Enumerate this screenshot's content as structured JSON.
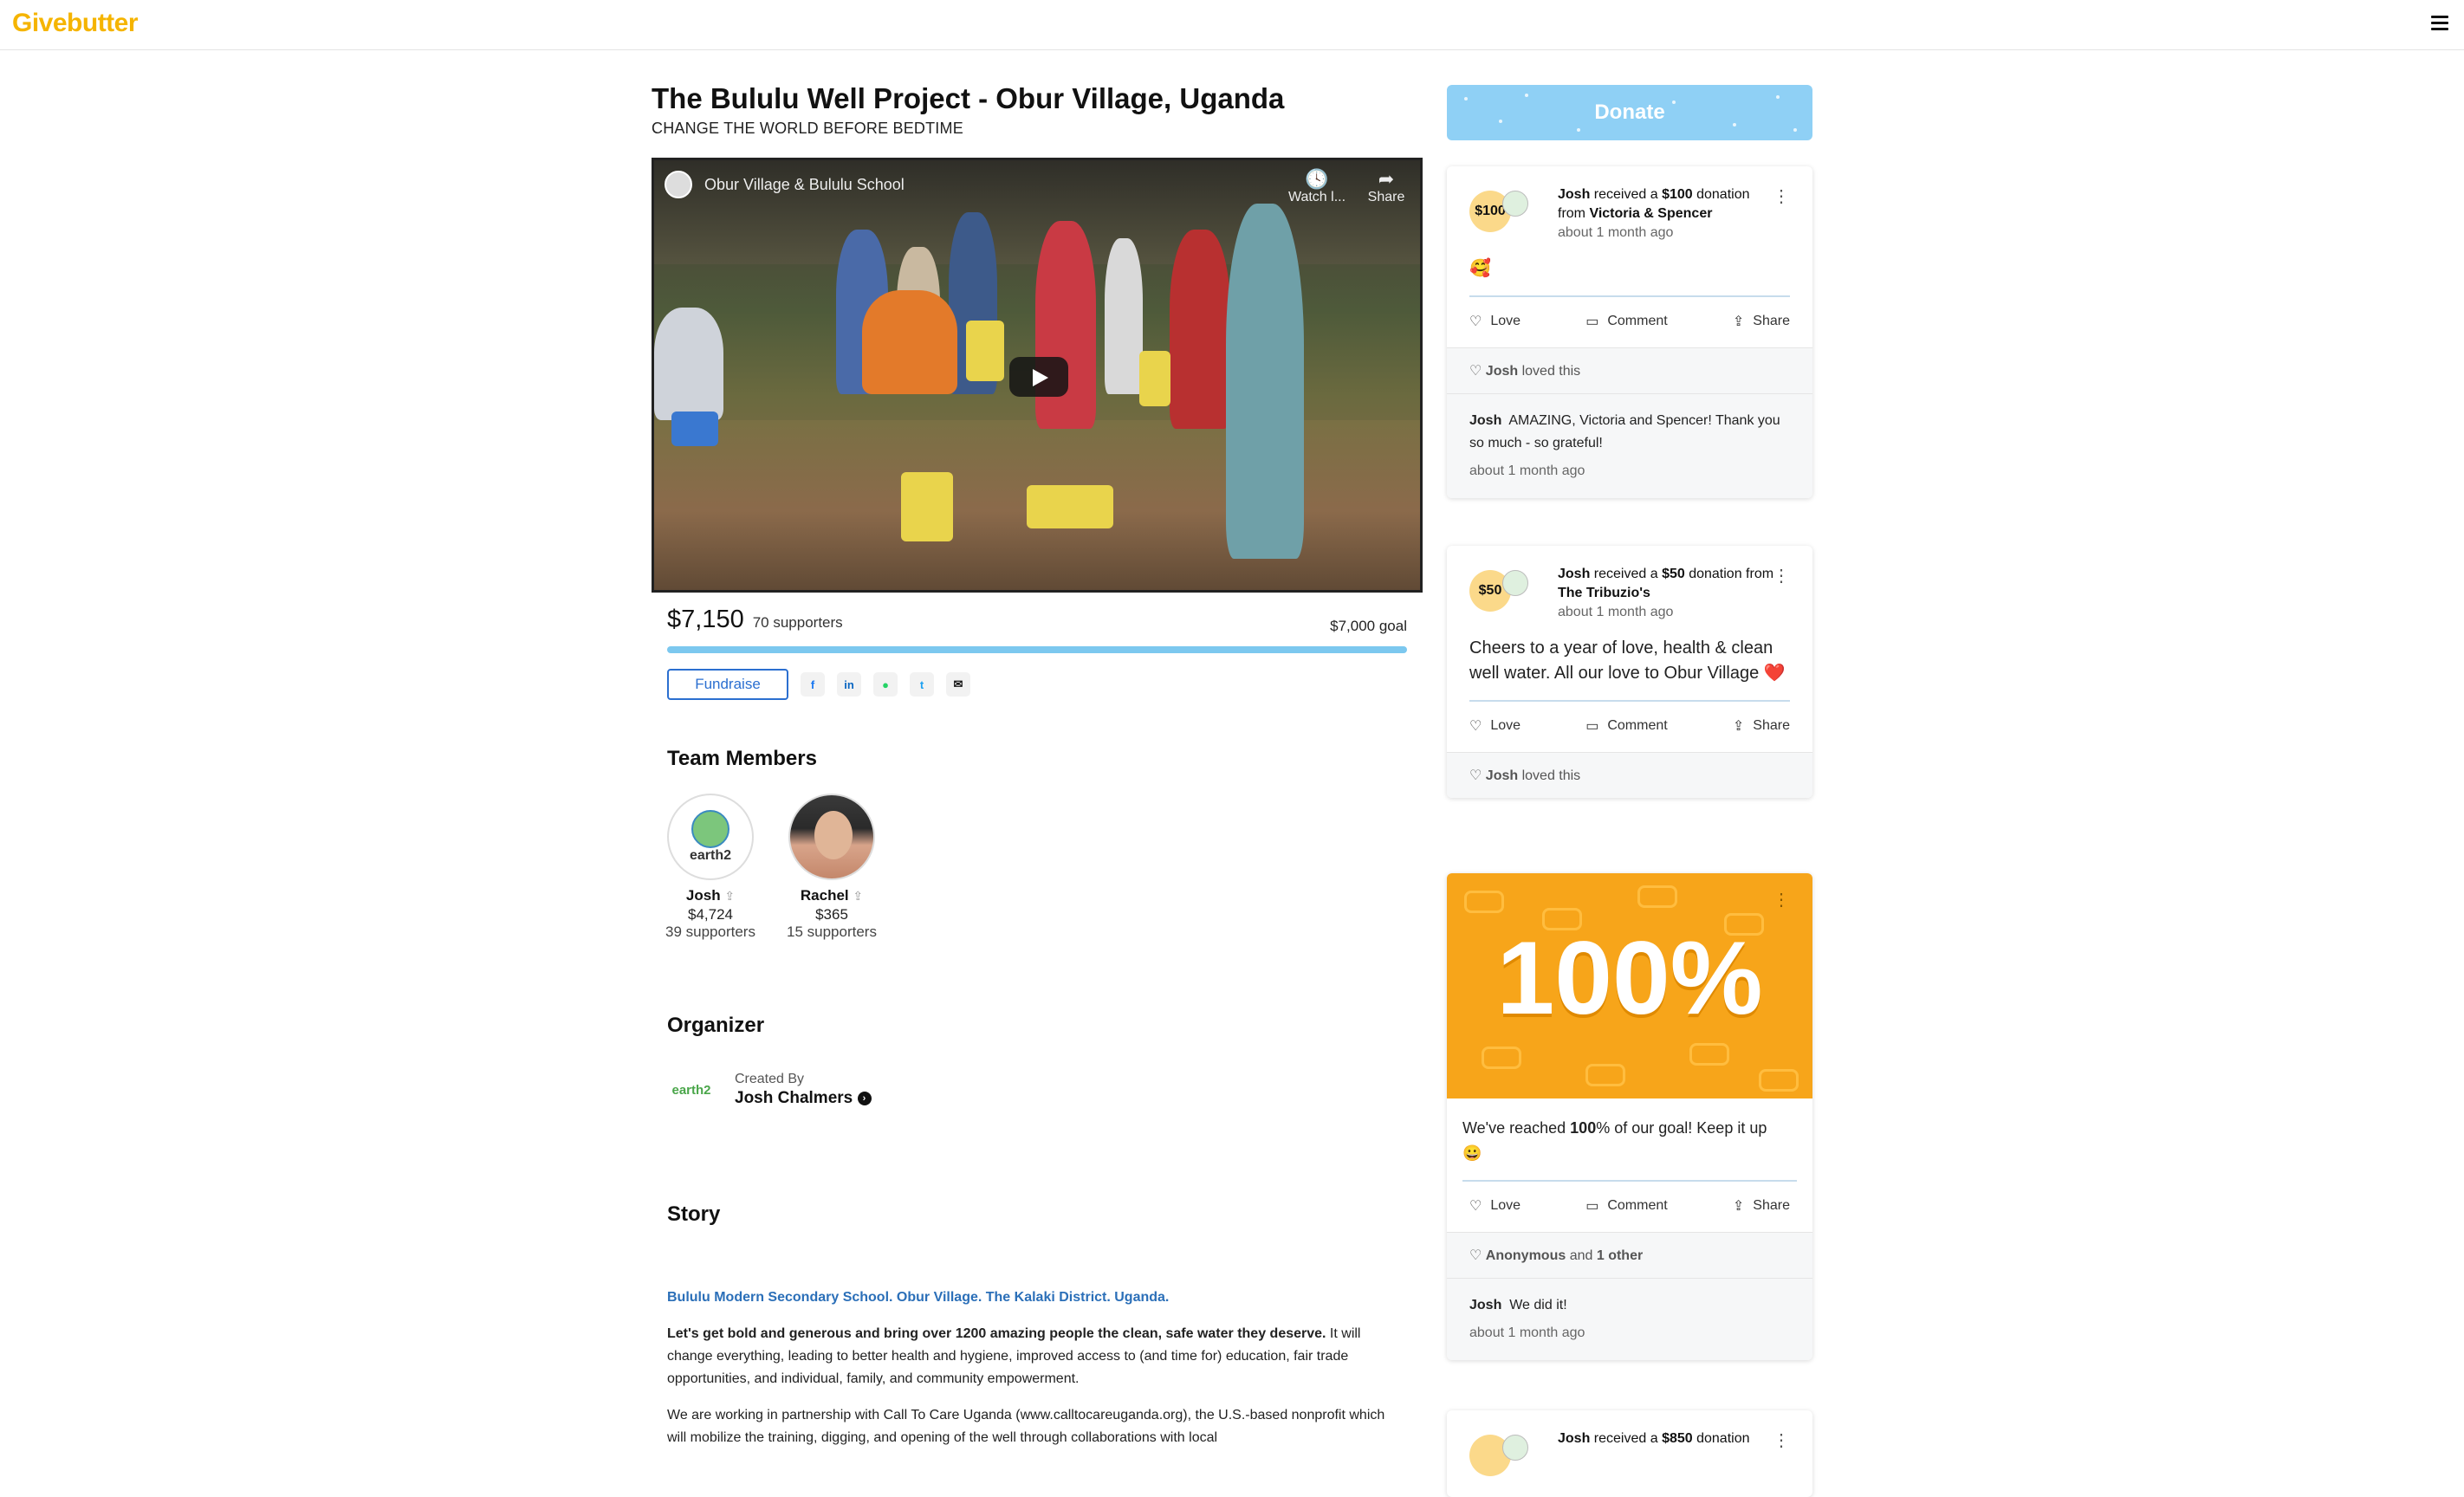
{
  "header": {
    "logo": "Givebutter"
  },
  "campaign": {
    "title": "The Bululu Well Project - Obur Village, Uganda",
    "subtitle": "CHANGE THE WORLD BEFORE BEDTIME",
    "video": {
      "channel_title": "Obur Village & Bululu School",
      "watch_label": "Watch l...",
      "share_label": "Share"
    },
    "raised": "$7,150",
    "supporters": "70 supporters",
    "goal": "$7,000 goal",
    "progress_fraction": 1.0,
    "fundraise_label": "Fundraise",
    "share_icons": [
      "facebook-icon",
      "linkedin-icon",
      "whatsapp-icon",
      "twitter-icon",
      "email-icon"
    ]
  },
  "team": {
    "heading": "Team Members",
    "members": [
      {
        "name": "Josh",
        "amount": "$4,724",
        "supporters": "39 supporters",
        "avatar_text": "earth2"
      },
      {
        "name": "Rachel",
        "amount": "$365",
        "supporters": "15 supporters"
      }
    ]
  },
  "organizer": {
    "heading": "Organizer",
    "created_by": "Created By",
    "name": "Josh Chalmers",
    "logo_text": "earth2"
  },
  "story": {
    "heading": "Story",
    "school_line": "Bululu Modern Secondary School. Obur Village. The Kalaki District. Uganda.",
    "p1_bold": "Let's get bold and generous and bring over 1200 amazing people the clean, safe water they deserve.",
    "p1_rest": " It will change everything, leading to better health and hygiene, improved access to (and time for) education, fair trade opportunities, and individual, family, and community empowerment.",
    "p2": "We are working in partnership with Call To Care Uganda (www.calltocareuganda.org), the U.S.-based nonprofit which will mobilize the training, digging, and opening of the well through collaborations with local"
  },
  "sidebar": {
    "donate_label": "Donate",
    "actions": {
      "love": "Love",
      "comment": "Comment",
      "share": "Share"
    },
    "cards": [
      {
        "badge": "$100",
        "who": "Josh",
        "received": " received a ",
        "amount": "$100",
        "donation": " donation from ",
        "donor": "Victoria & Spencer",
        "ago": "about 1 month ago",
        "body": "🥰",
        "loved_by": "Josh",
        "loved_text": " loved this",
        "comment_author": "Josh",
        "comment_text": "AMAZING, Victoria and Spencer! Thank you so much - so grateful!",
        "comment_ago": "about 1 month ago"
      },
      {
        "badge": "$50",
        "who": "Josh",
        "received": " received a ",
        "amount": "$50",
        "donation": " donation from ",
        "donor": "The Tribuzio's",
        "ago": "about 1 month ago",
        "body": "Cheers to a year of love, health & clean well water. All our love to Obur Village ❤️",
        "loved_by": "Josh",
        "loved_text": " loved this"
      },
      {
        "banner": "100%",
        "body_pre": "We've reached ",
        "body_bold": "100",
        "body_post": "% of our goal! Keep it up 😀",
        "loved_by": "Anonymous",
        "loved_and": " and ",
        "loved_other": "1 other",
        "comment_author": "Josh",
        "comment_text": "We did it!",
        "comment_ago": "about 1 month ago"
      },
      {
        "badge": "",
        "who": "Josh",
        "received": " received a ",
        "amount": "$850",
        "donation": " donation"
      }
    ]
  }
}
